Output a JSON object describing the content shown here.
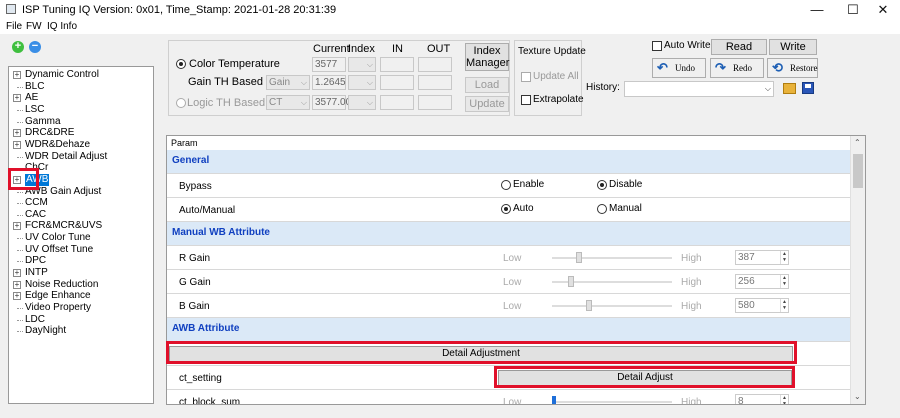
{
  "window": {
    "title": "ISP Tuning IQ Version: 0x01, Time_Stamp: 2021-01-28 20:31:39",
    "minimize": "—",
    "maximize": "☐",
    "close": "✕"
  },
  "menu": [
    "File",
    "FW",
    "IQ Info"
  ],
  "toolbar_icons": {
    "add": "+",
    "remove": "−",
    "add_color": "#3fbf3f",
    "remove_color": "#3a8ee6"
  },
  "tree": {
    "items": [
      {
        "label": "Dynamic Control",
        "expandable": true
      },
      {
        "label": "BLC",
        "expandable": false
      },
      {
        "label": "AE",
        "expandable": true
      },
      {
        "label": "LSC",
        "expandable": false
      },
      {
        "label": "Gamma",
        "expandable": false
      },
      {
        "label": "DRC&DRE",
        "expandable": true
      },
      {
        "label": "WDR&Dehaze",
        "expandable": true
      },
      {
        "label": "WDR Detail Adjust",
        "expandable": false
      },
      {
        "label": "ChCr",
        "expandable": false
      },
      {
        "label": "AWB",
        "expandable": true,
        "selected": true
      },
      {
        "label": "AWB Gain Adjust",
        "expandable": false
      },
      {
        "label": "CCM",
        "expandable": false
      },
      {
        "label": "CAC",
        "expandable": false
      },
      {
        "label": "FCR&MCR&UVS",
        "expandable": true
      },
      {
        "label": "UV Color Tune",
        "expandable": false
      },
      {
        "label": "UV Offset Tune",
        "expandable": false
      },
      {
        "label": "DPC",
        "expandable": false
      },
      {
        "label": "INTP",
        "expandable": true
      },
      {
        "label": "Noise Reduction",
        "expandable": true
      },
      {
        "label": "Edge Enhance",
        "expandable": true
      },
      {
        "label": "Video Property",
        "expandable": false
      },
      {
        "label": "LDC",
        "expandable": false
      },
      {
        "label": "DayNight",
        "expandable": false
      }
    ]
  },
  "dyn": {
    "headers": {
      "current": "Current",
      "index": "Index",
      "in": "IN",
      "out": "OUT"
    },
    "color_temp_label": "Color Temperature",
    "color_temp_value": "3577",
    "gain_th_label": "Gain TH Based on",
    "gain_th_combo": "Gain",
    "gain_th_value": "1.2645",
    "logic_th_label": "Logic TH Based on",
    "logic_th_combo": "CT",
    "logic_th_value": "3577.00",
    "index_manager": "Index\nManager",
    "load": "Load",
    "update": "Update"
  },
  "texture": {
    "title": "Texture Update",
    "update_all": "Update All",
    "extrapolate": "Extrapolate"
  },
  "io": {
    "auto_write": "Auto Write",
    "read": "Read",
    "write": "Write",
    "undo": "Undo",
    "redo": "Redo",
    "restore": "Restore",
    "history": "History:",
    "history_value": ""
  },
  "grid": {
    "column": "Param",
    "rows": [
      {
        "type": "header",
        "name": "General"
      },
      {
        "type": "radio",
        "name": "Bypass",
        "options": [
          "Enable",
          "Disable"
        ],
        "selected": 1
      },
      {
        "type": "radio",
        "name": "Auto/Manual",
        "options": [
          "Auto",
          "Manual"
        ],
        "selected": 0
      },
      {
        "type": "header",
        "name": "Manual WB Attribute"
      },
      {
        "type": "slider",
        "name": "R Gain",
        "low": "Low",
        "high": "High",
        "value": "387",
        "pos": 0.2
      },
      {
        "type": "slider",
        "name": "G Gain",
        "low": "Low",
        "high": "High",
        "value": "256",
        "pos": 0.13
      },
      {
        "type": "slider",
        "name": "B Gain",
        "low": "Low",
        "high": "High",
        "value": "580",
        "pos": 0.28
      },
      {
        "type": "header",
        "name": "AWB Attribute"
      },
      {
        "type": "fullbutton",
        "label": "Detail Adjustment"
      },
      {
        "type": "button",
        "name": "ct_setting",
        "label": "Detail Adjust"
      },
      {
        "type": "slider",
        "name": "ct_block_sum",
        "low": "Low",
        "high": "High",
        "value": "8",
        "pos": 0.0
      }
    ]
  },
  "highlight_color": "#e0102a",
  "selection_color": "#0078d7"
}
